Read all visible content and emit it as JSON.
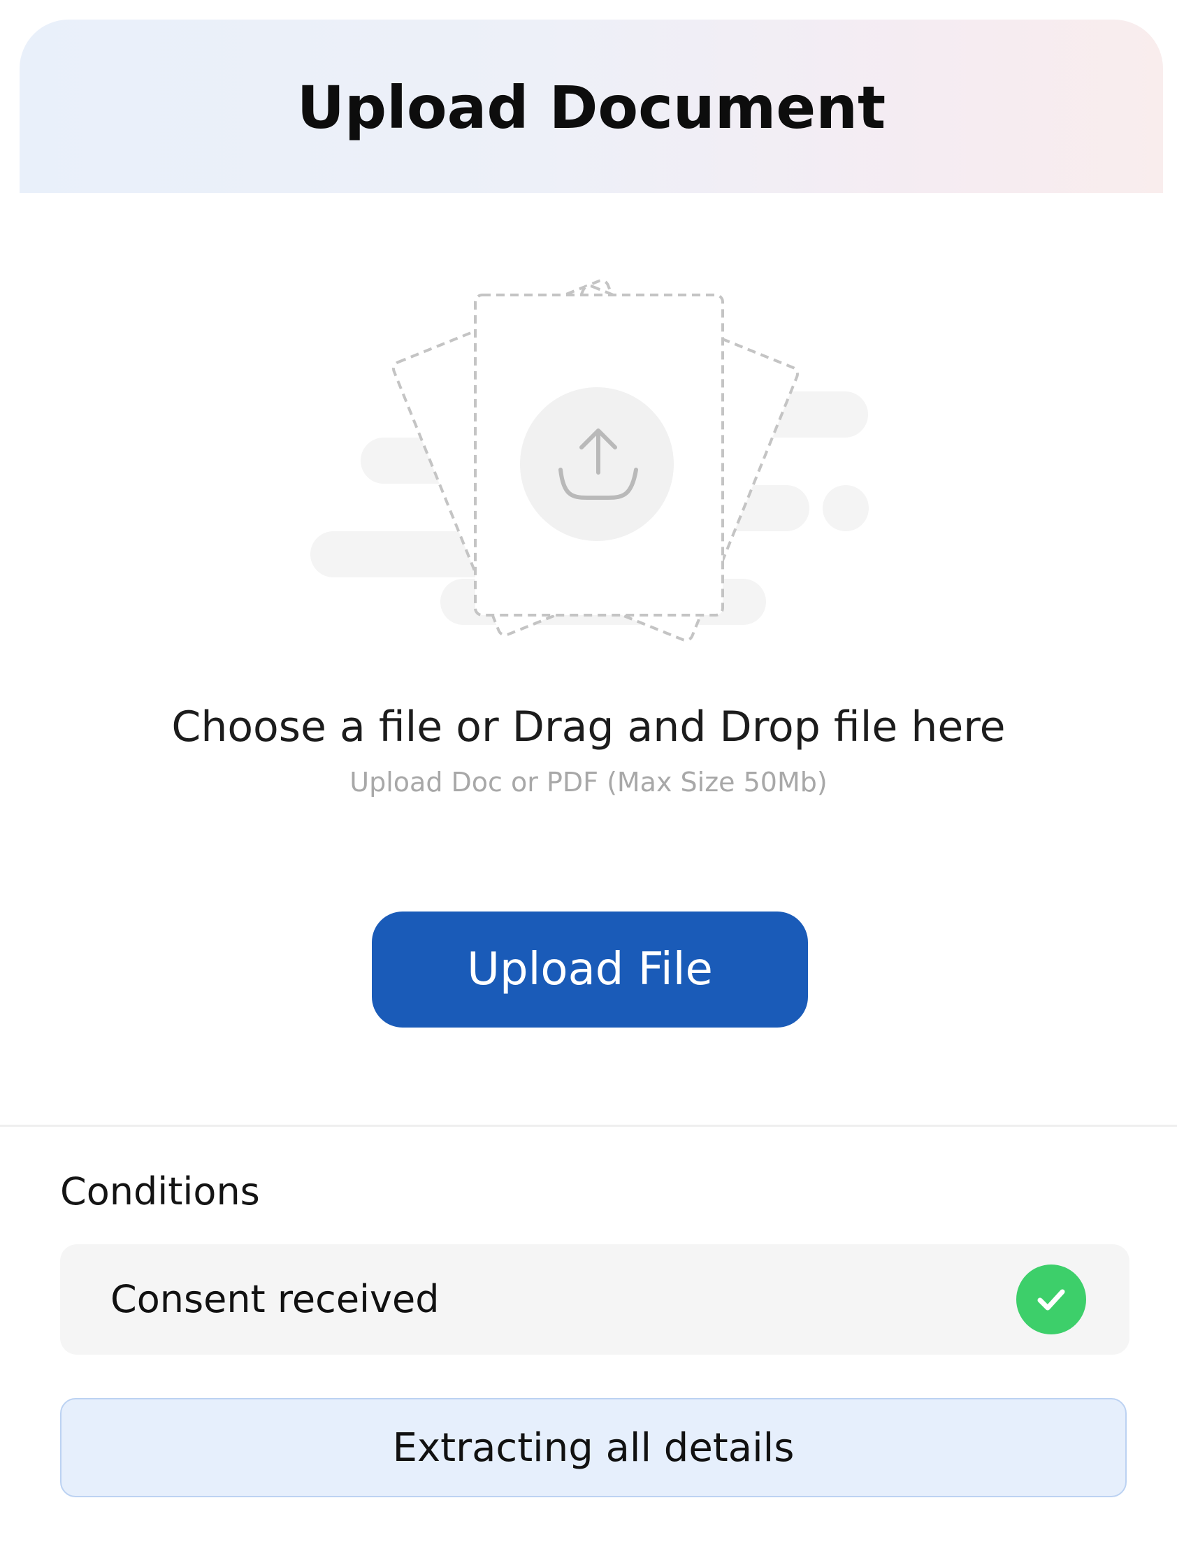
{
  "header": {
    "title": "Upload Document"
  },
  "dropzone": {
    "title": "Choose a file or Drag and Drop file here",
    "subtitle": "Upload Doc or PDF (Max Size 50Mb)",
    "illustration_icon": "upload-tray-icon"
  },
  "upload_button": {
    "label": "Upload File"
  },
  "conditions": {
    "label": "Conditions",
    "items": [
      {
        "label": "Consent received",
        "status_icon": "check-circle-icon"
      }
    ]
  },
  "status_button": {
    "label": "Extracting all details"
  },
  "colors": {
    "primary": "#1a5bb8",
    "success": "#3dcf6a",
    "status_bg": "#e6effc",
    "status_border": "#bcd2f2",
    "row_bg": "#f5f5f5"
  }
}
